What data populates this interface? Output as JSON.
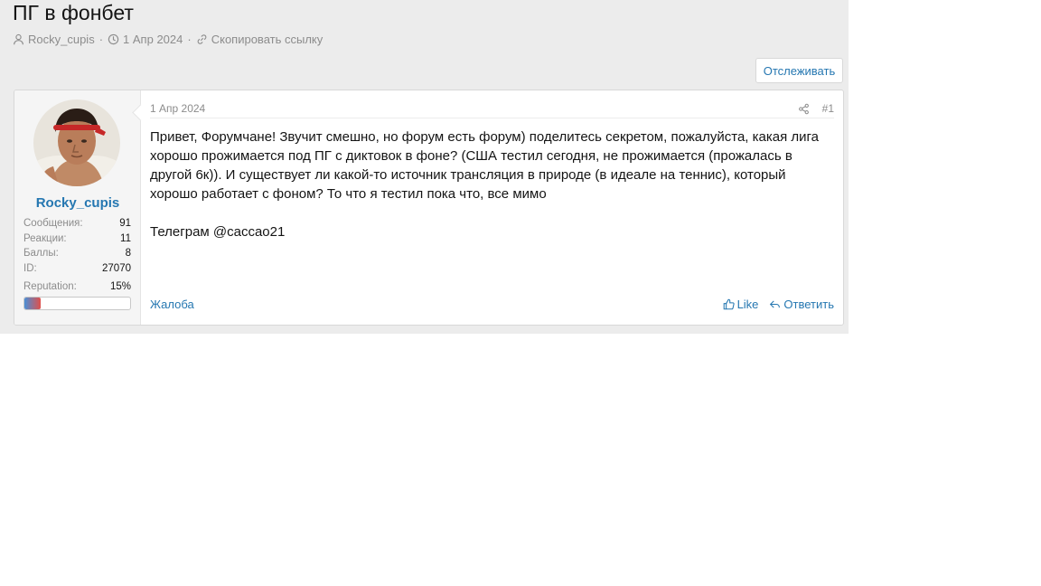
{
  "thread": {
    "title": "ПГ в фонбет",
    "author": "Rocky_cupis",
    "date": "1 Апр 2024",
    "copy_link_label": "Скопировать ссылку",
    "separator": "·"
  },
  "watch_button": {
    "label": "Отслеживать"
  },
  "post": {
    "date": "1 Апр 2024",
    "number": "#1",
    "paragraphs": [
      "Привет, Форумчане! Звучит смешно, но форум есть форум) поделитесь секретом, пожалуйста, какая лига хорошо прожимается под ПГ с диктовок в фоне? (США тестил сегодня, не прожимается (прожалась в другой 6к)). И существует ли какой-то источник трансляция в природе (в идеале на теннис), который хорошо работает с фоном? То что я тестил пока что, все мимо",
      "Телеграм @caccao21"
    ],
    "report_label": "Жалоба",
    "like_label": "Like",
    "reply_label": "Ответить"
  },
  "user": {
    "name": "Rocky_cupis",
    "stats": [
      {
        "label": "Сообщения:",
        "value": "91"
      },
      {
        "label": "Реакции:",
        "value": "11"
      },
      {
        "label": "Баллы:",
        "value": "8"
      },
      {
        "label": "ID:",
        "value": "27070"
      }
    ],
    "reputation_label": "Reputation:",
    "reputation_value": "15%",
    "reputation_fraction": 0.15
  },
  "colors": {
    "link": "#2577b1",
    "muted": "#8c8c8c",
    "page_bg": "#ececec"
  },
  "icons": [
    "user-icon",
    "clock-icon",
    "link-icon",
    "share-icon",
    "thumbs-up-icon",
    "reply-icon"
  ]
}
